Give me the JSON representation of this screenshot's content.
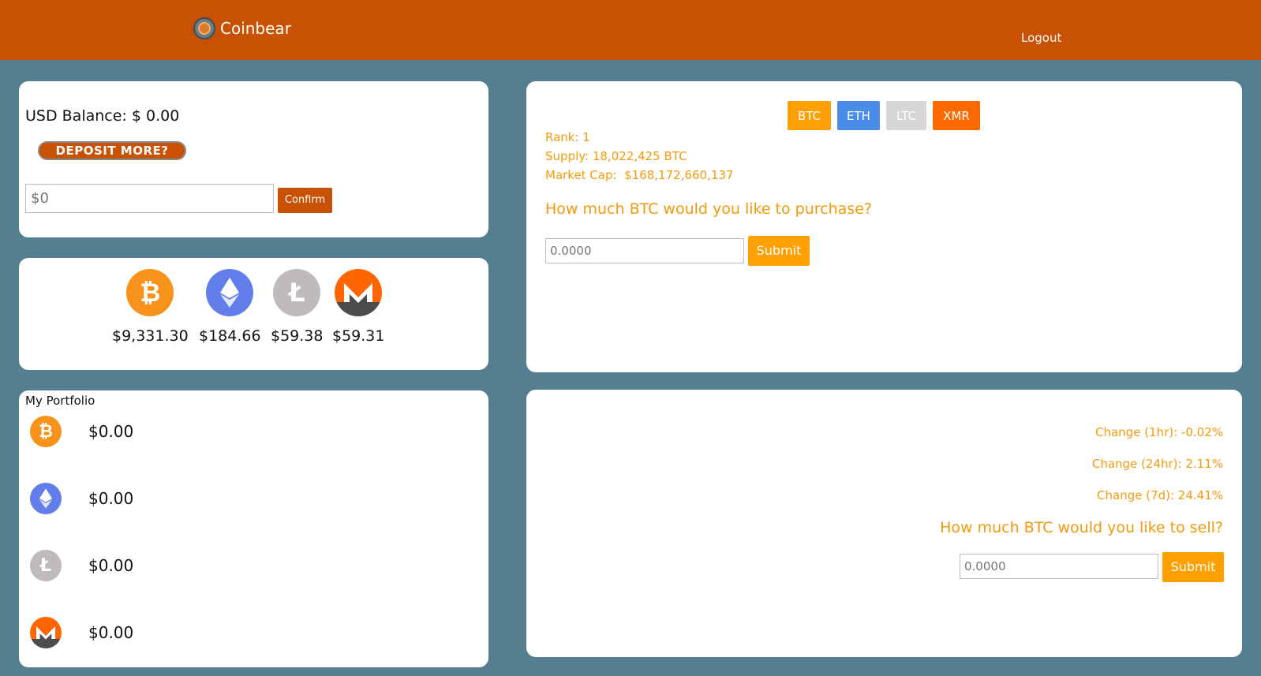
{
  "header": {
    "brand": "Coinbear",
    "logout": "Logout"
  },
  "balance": {
    "label": "USD Balance: $ 0.00",
    "deposit_button": "DEPOSIT MORE?",
    "input_placeholder": "$0",
    "confirm_button": "Confirm"
  },
  "prices": [
    {
      "coin": "BTC",
      "icon": "bitcoin-icon",
      "color": "#f7931a",
      "price": "$9,331.30"
    },
    {
      "coin": "ETH",
      "icon": "ethereum-icon",
      "color": "#627eea",
      "price": "$184.66"
    },
    {
      "coin": "LTC",
      "icon": "litecoin-icon",
      "color": "#bfbbbb",
      "price": "$59.38"
    },
    {
      "coin": "XMR",
      "icon": "monero-icon",
      "color": "#ff6600",
      "price": "$59.31"
    }
  ],
  "portfolio": {
    "title": "My Portfolio",
    "items": [
      {
        "coin": "BTC",
        "icon": "bitcoin-icon",
        "value": "$0.00"
      },
      {
        "coin": "ETH",
        "icon": "ethereum-icon",
        "value": "$0.00"
      },
      {
        "coin": "LTC",
        "icon": "litecoin-icon",
        "value": "$0.00"
      },
      {
        "coin": "XMR",
        "icon": "monero-icon",
        "value": "$0.00"
      }
    ]
  },
  "buy": {
    "tabs": [
      {
        "label": "BTC",
        "color": "#ff9f00"
      },
      {
        "label": "ETH",
        "color": "#4a8de8"
      },
      {
        "label": "LTC",
        "color": "#d6d6d6"
      },
      {
        "label": "XMR",
        "color": "#ff6a00"
      }
    ],
    "rank": "Rank: 1",
    "supply": "Supply: 18,022,425 BTC",
    "market_cap": "Market Cap:  $168,172,660,137",
    "question": "How much BTC would you like to purchase?",
    "input_placeholder": "0.0000",
    "submit": "Submit"
  },
  "sell": {
    "change_1h": "Change (1hr): -0.02%",
    "change_24h": "Change (24hr): 2.11%",
    "change_7d": "Change (7d): 24.41%",
    "question": "How much BTC would you like to sell?",
    "input_placeholder": "0.0000",
    "submit": "Submit"
  },
  "colors": {
    "header": "#c85104",
    "background": "#537f91",
    "accent": "#ff9f00"
  }
}
